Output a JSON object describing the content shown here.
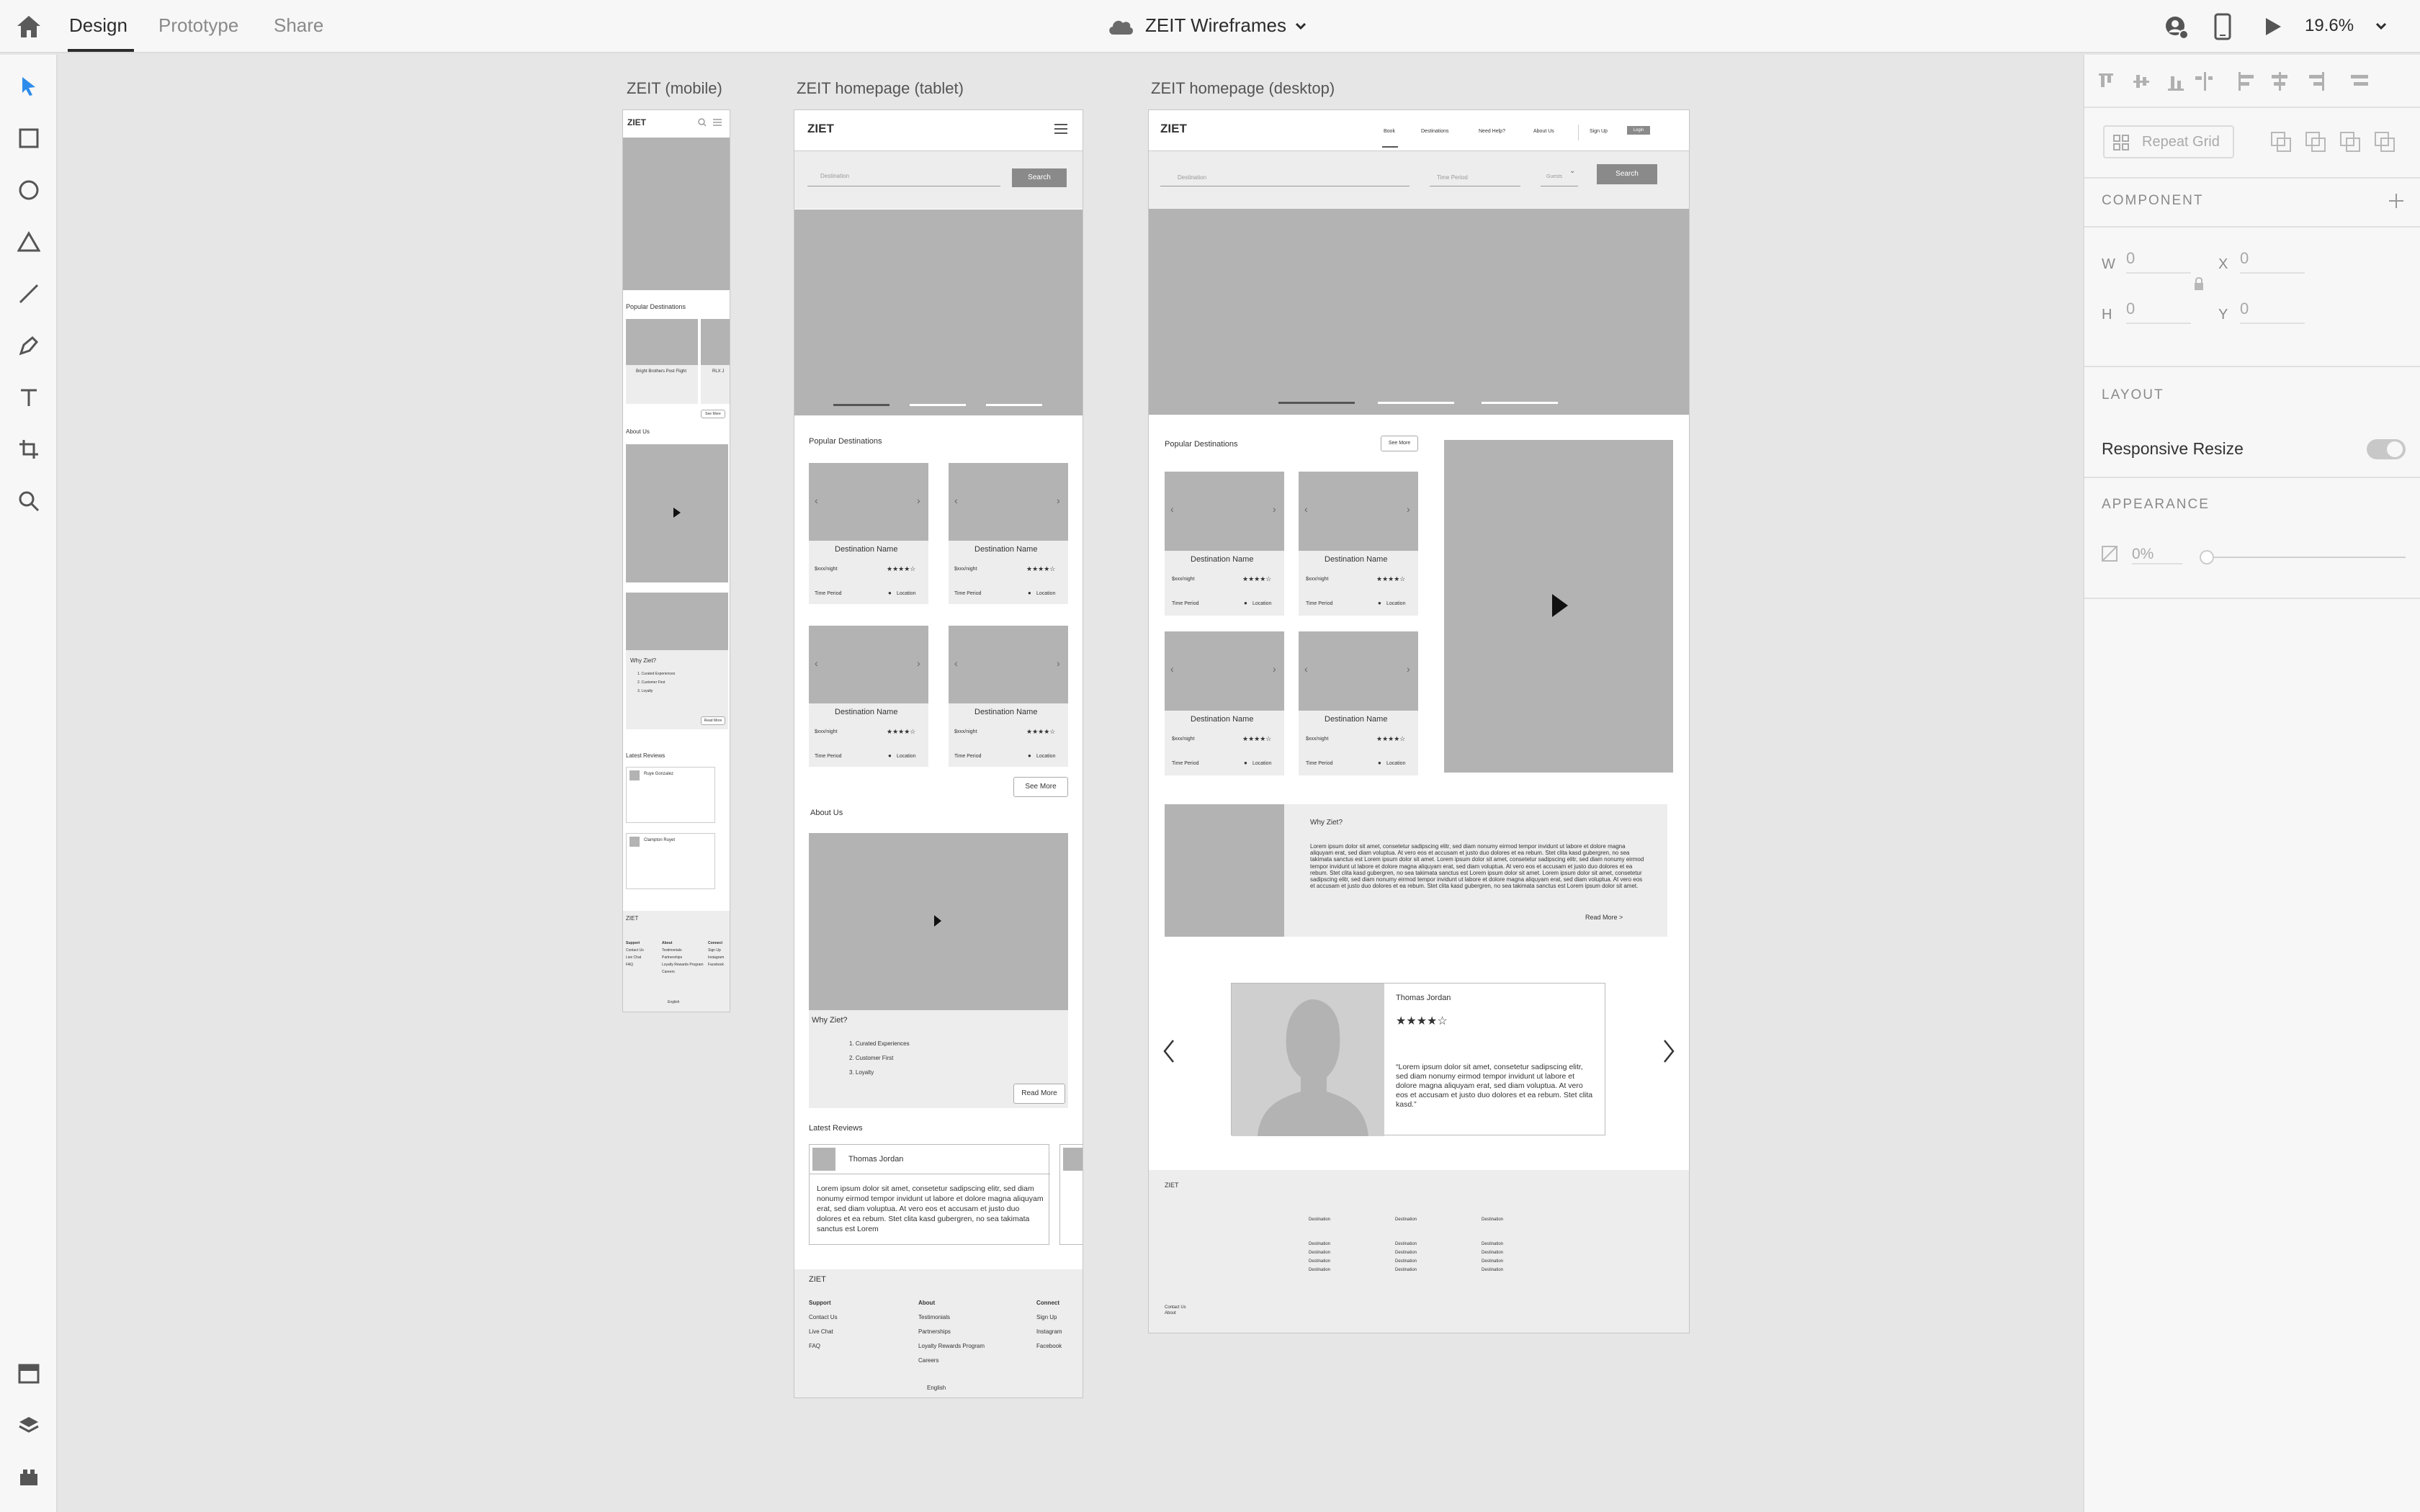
{
  "topbar": {
    "tabs": [
      {
        "label": "Design"
      },
      {
        "label": "Prototype"
      },
      {
        "label": "Share"
      }
    ],
    "doc_title": "ZEIT Wireframes",
    "zoom": "19.6%"
  },
  "right_panel": {
    "repeat_grid": "Repeat Grid",
    "component_header": "COMPONENT",
    "w_label": "W",
    "w_value": "0",
    "x_label": "X",
    "x_value": "0",
    "h_label": "H",
    "h_value": "0",
    "y_label": "Y",
    "y_value": "0",
    "layout_header": "LAYOUT",
    "responsive_resize": "Responsive Resize",
    "appearance_header": "APPEARANCE",
    "opacity": "0%"
  },
  "artboards": {
    "mobile": {
      "label": "ZEIT (mobile)",
      "logo": "ZIET",
      "popular": "Popular Destinations",
      "card_name": "Bright Brothers Post Flight",
      "card_name2": "RLX J",
      "see_more": "See More",
      "about": "About Us",
      "why": "Why Ziet?",
      "list": [
        "1. Curated Experiences",
        "2. Customer First",
        "3. Loyalty"
      ],
      "read_more": "Read More",
      "latest": "Latest Reviews",
      "reviewer1": "Ruye Gonzalez",
      "reviewer2": "Clampton Ruyet",
      "footer_logo": "ZIET",
      "footer_cols": [
        {
          "head": "Support",
          "items": [
            "Contact Us",
            "Live Chat",
            "FAQ"
          ]
        },
        {
          "head": "About",
          "items": [
            "Testimonials",
            "Partnerships",
            "Loyalty Rewards Program",
            "Careers"
          ]
        },
        {
          "head": "Connect",
          "items": [
            "Sign Up",
            "Instagram",
            "Facebook"
          ]
        }
      ],
      "lang": "English"
    },
    "tablet": {
      "label": "ZEIT homepage (tablet)",
      "logo": "ZIET",
      "dest_placeholder": "Destination",
      "search": "Search",
      "popular": "Popular Destinations",
      "cards": [
        {
          "name": "Destination Name",
          "price": "$xxx/night",
          "stars": "★★★★☆",
          "period": "Time Period",
          "location": "Location"
        },
        {
          "name": "Destination Name",
          "price": "$xxx/night",
          "stars": "★★★★☆",
          "period": "Time Period",
          "location": "Location"
        },
        {
          "name": "Destination Name",
          "price": "$xxx/night",
          "stars": "★★★★☆",
          "period": "Time Period",
          "location": "Location"
        },
        {
          "name": "Destination Name",
          "price": "$xxx/night",
          "stars": "★★★★☆",
          "period": "Time Period",
          "location": "Location"
        }
      ],
      "see_more": "See More",
      "about": "About Us",
      "why": "Why Ziet?",
      "list": [
        "1. Curated Experiences",
        "2. Customer First",
        "3. Loyalty"
      ],
      "read_more": "Read More",
      "latest": "Latest Reviews",
      "reviewer": "Thomas Jordan",
      "review_text": "Lorem ipsum dolor sit amet, consetetur sadipscing elitr, sed diam nonumy eirmod tempor invidunt ut labore et dolore magna aliquyam erat, sed diam voluptua. At vero eos et accusam et justo duo dolores et ea rebum. Stet clita kasd gubergren, no sea takimata sanctus est Lorem",
      "footer_logo": "ZIET",
      "footer_cols": [
        {
          "head": "Support",
          "items": [
            "Contact Us",
            "Live Chat",
            "FAQ"
          ]
        },
        {
          "head": "About",
          "items": [
            "Testimonials",
            "Partnerships",
            "Loyalty Rewards Program",
            "Careers"
          ]
        },
        {
          "head": "Connect",
          "items": [
            "Sign Up",
            "Instagram",
            "Facebook"
          ]
        }
      ],
      "lang": "English"
    },
    "desktop": {
      "label": "ZEIT homepage (desktop)",
      "logo": "ZIET",
      "nav": [
        "Book",
        "Destinations",
        "Need Help?",
        "About Us"
      ],
      "signup": "Sign Up",
      "login": "Login",
      "dest_placeholder": "Destination",
      "time_placeholder": "Time Period",
      "guests_placeholder": "Guests",
      "search": "Search",
      "popular": "Popular Destinations",
      "see_more": "See More",
      "cards": [
        {
          "name": "Destination Name",
          "price": "$xxx/night",
          "stars": "★★★★☆",
          "period": "Time Period",
          "location": "Location"
        },
        {
          "name": "Destination Name",
          "price": "$xxx/night",
          "stars": "★★★★☆",
          "period": "Time Period",
          "location": "Location"
        },
        {
          "name": "Destination Name",
          "price": "$xxx/night",
          "stars": "★★★★☆",
          "period": "Time Period",
          "location": "Location"
        },
        {
          "name": "Destination Name",
          "price": "$xxx/night",
          "stars": "★★★★☆",
          "period": "Time Period",
          "location": "Location"
        }
      ],
      "why": "Why Ziet?",
      "why_text": "Lorem ipsum dolor sit amet, consetetur sadipscing elitr, sed diam nonumy eirmod tempor invidunt ut labore et dolore magna aliquyam erat, sed diam voluptua. At vero eos et accusam et justo duo dolores et ea rebum. Stet clita kasd gubergren, no sea takimata sanctus est Lorem ipsum dolor sit amet. Lorem ipsum dolor sit amet, consetetur sadipscing elitr, sed diam nonumy eirmod tempor invidunt ut labore et dolore magna aliquyam erat, sed diam voluptua. At vero eos et accusam et justo duo dolores et ea rebum. Stet clita kasd gubergren, no sea takimata sanctus est Lorem ipsum dolor sit amet. Lorem ipsum dolor sit amet, consetetur sadipscing elitr, sed diam nonumy eirmod tempor invidunt ut labore et dolore magna aliquyam erat, sed diam voluptua. At vero eos et accusam et justo duo dolores et ea rebum. Stet clita kasd gubergren, no sea takimata sanctus est Lorem ipsum dolor sit amet.",
      "read_more": "Read More >",
      "reviewer": "Thomas Jordan",
      "review_stars": "★★★★☆",
      "review_text": "“Lorem ipsum dolor sit amet, consetetur sadipscing elitr, sed diam nonumy eirmod tempor invidunt ut labore et dolore magna aliquyam erat, sed diam voluptua. At vero eos et accusam et justo duo dolores et ea rebum. Stet clita kasd.”",
      "footer_logo": "ZIET",
      "footer_head": "Destination",
      "footer_item": "Destination",
      "footer_links": [
        "Contact Us",
        "About"
      ]
    }
  }
}
